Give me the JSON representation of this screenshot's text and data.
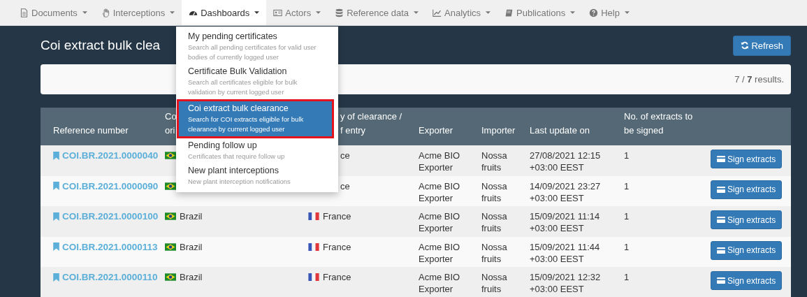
{
  "navbar": {
    "items": [
      {
        "label": "Documents",
        "selected": false
      },
      {
        "label": "Interceptions",
        "selected": false
      },
      {
        "label": "Dashboards",
        "selected": true
      },
      {
        "label": "Actors",
        "selected": false
      },
      {
        "label": "Reference data",
        "selected": false
      },
      {
        "label": "Analytics",
        "selected": false
      },
      {
        "label": "Publications",
        "selected": false
      },
      {
        "label": "Help",
        "selected": false
      }
    ]
  },
  "page_title": "Coi extract bulk clea",
  "refresh_button": "Refresh",
  "results": "7 / **7** results.",
  "table": {
    "columns": [
      {
        "lines": [
          "Reference number"
        ]
      },
      {
        "lines": [
          "Co",
          "ori"
        ]
      },
      {},
      {
        "lines": [
          "y of clearance /",
          "f entry"
        ]
      },
      {
        "lines": [
          "Exporter"
        ]
      },
      {
        "lines": [
          "Importer"
        ]
      },
      {
        "lines": [
          "Last update on"
        ]
      },
      {
        "lines": [
          "No. of extracts to",
          "be signed"
        ]
      }
    ],
    "rows": [
      {
        "reference": "COI.BR.2021.0000040",
        "origin_flag": true,
        "destination": "ce",
        "destination_flag": false,
        "exporter": "Acme BIO Exporter",
        "importer": "Nossa fruits",
        "updated": "27/08/2021 12:15 +03:00 EEST",
        "extracts": "1",
        "button": "Sign extracts"
      },
      {
        "reference": "COI.BR.2021.0000090",
        "origin_flag": true,
        "destination": "ce",
        "destination_flag": false,
        "exporter": "Acme BIO Exporter",
        "importer": "Nossa fruits",
        "updated": "14/09/2021 23:27 +03:00 EEST",
        "extracts": "1",
        "button": "Sign extracts"
      },
      {
        "reference": "COI.BR.2021.0000100",
        "origin": "Brazil",
        "origin_flag": true,
        "destination": "France",
        "destination_flag": true,
        "exporter": "Acme BIO Exporter",
        "importer": "Nossa fruits",
        "updated": "15/09/2021 11:14 +03:00 EEST",
        "extracts": "1",
        "button": "Sign extracts"
      },
      {
        "reference": "COI.BR.2021.0000113",
        "origin": "Brazil",
        "origin_flag": true,
        "destination": "France",
        "destination_flag": true,
        "exporter": "Acme BIO Exporter",
        "importer": "Nossa fruits",
        "updated": "15/09/2021 11:44 +03:00 EEST",
        "extracts": "1",
        "button": "Sign extracts"
      },
      {
        "reference": "COI.BR.2021.0000110",
        "origin": "Brazil",
        "origin_flag": true,
        "destination": "France",
        "destination_flag": true,
        "exporter": "Acme BIO Exporter",
        "importer": "Nossa fruits",
        "updated": "15/09/2021 12:32 +03:00 EEST",
        "extracts": "1",
        "button": "Sign extracts"
      }
    ]
  },
  "dropdown": {
    "items": [
      {
        "title": "My pending certificates",
        "description": "Search all pending certificates for valid user bodies of currently logged user",
        "selected": false
      },
      {
        "title": "Certificate Bulk Validation",
        "description": "Search all certificates eligible for bulk validation by current logged user",
        "selected": false
      },
      {
        "title": "Coi extract bulk clearance",
        "description": "Search for COI extracts eligible for bulk clearance by current logged user",
        "selected": true
      },
      {
        "title": "Pending follow up",
        "description": "Certificates that require follow up",
        "selected": false
      },
      {
        "title": "New plant interceptions",
        "description": "New plant interception notifications",
        "selected": false
      }
    ]
  }
}
